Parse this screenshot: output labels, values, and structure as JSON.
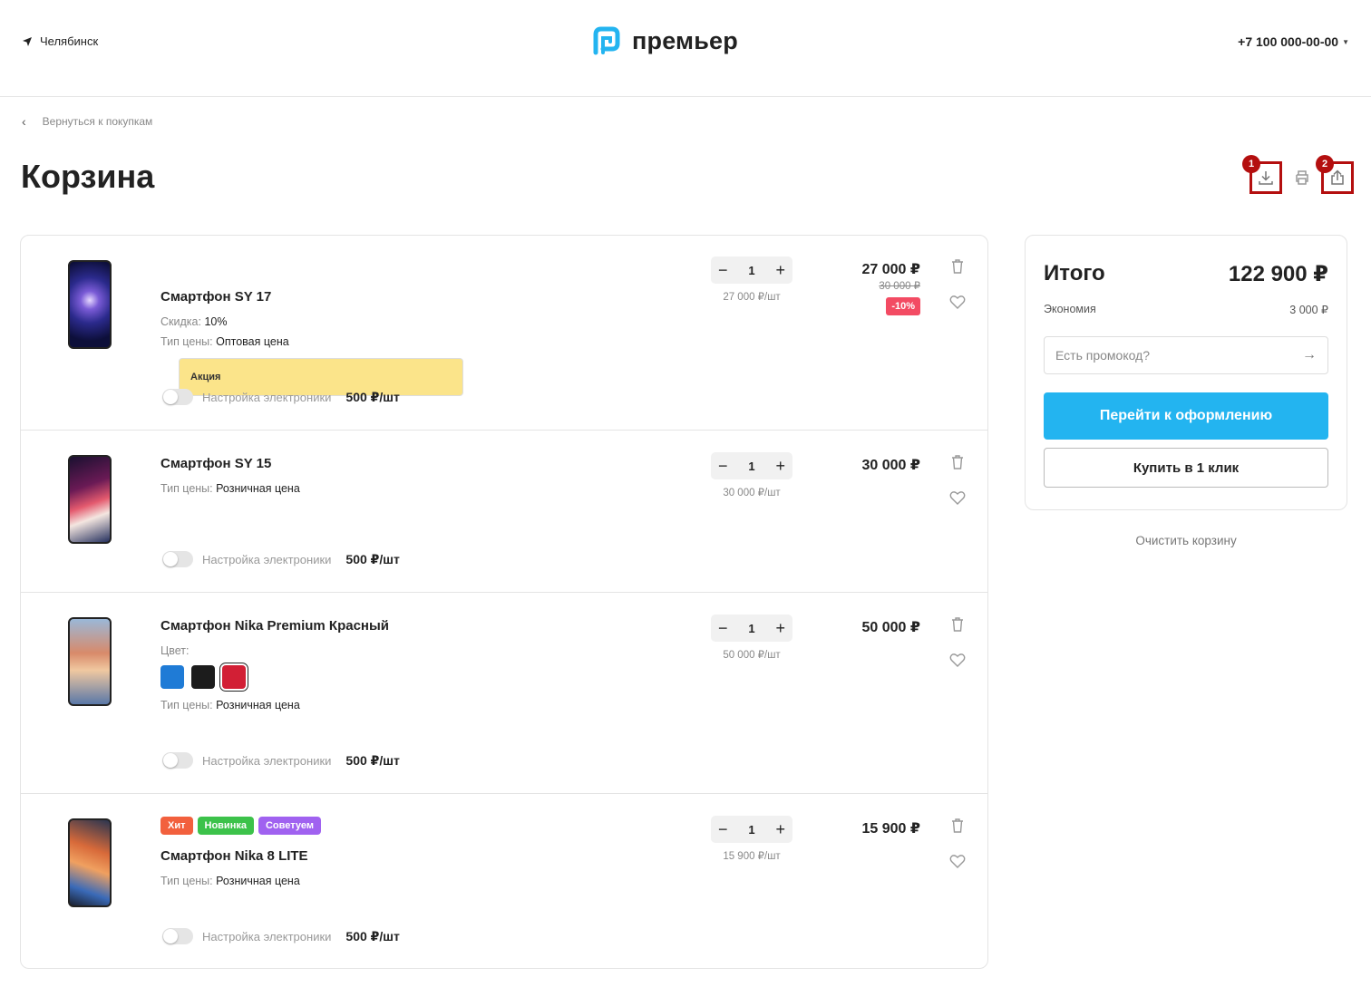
{
  "header": {
    "city": "Челябинск",
    "logo_text": "премьер",
    "phone": "+7 100 000-00-00",
    "brand_color": "#23b4f0"
  },
  "back_link": "Вернуться к покупкам",
  "page_title": "Корзина",
  "toolbar": {
    "markers": [
      "1",
      "2"
    ],
    "icons": [
      "download-icon",
      "print-icon",
      "share-icon"
    ]
  },
  "items": [
    {
      "badges": [
        "Акция"
      ],
      "name": "Смартфон SY 17",
      "props": [
        {
          "label": "Скидка:",
          "value": "10%"
        },
        {
          "label": "Тип цены:",
          "value": "Оптовая цена"
        }
      ],
      "service_label": "Настройка электроники",
      "service_price": "500 ₽/шт",
      "qty": "1",
      "unit_price": "27 000 ₽/шт",
      "total": "27 000 ₽",
      "old_price": "30 000 ₽",
      "discount": "-10%"
    },
    {
      "badges": [],
      "name": "Смартфон SY 15",
      "props": [
        {
          "label": "Тип цены:",
          "value": "Розничная цена"
        }
      ],
      "service_label": "Настройка электроники",
      "service_price": "500 ₽/шт",
      "qty": "1",
      "unit_price": "30 000 ₽/шт",
      "total": "30 000 ₽"
    },
    {
      "badges": [],
      "name": "Смартфон Nika Premium Красный",
      "color_label": "Цвет:",
      "colors": [
        "#1f7bd6",
        "#1c1c1c",
        "#d21f35"
      ],
      "selected_color": 2,
      "props": [
        {
          "label": "Тип цены:",
          "value": "Розничная цена"
        }
      ],
      "service_label": "Настройка электроники",
      "service_price": "500 ₽/шт",
      "qty": "1",
      "unit_price": "50 000 ₽/шт",
      "total": "50 000 ₽"
    },
    {
      "badges": [
        "Хит",
        "Новинка",
        "Советуем"
      ],
      "name": "Смартфон Nika 8 LITE",
      "props": [
        {
          "label": "Тип цены:",
          "value": "Розничная цена"
        }
      ],
      "service_label": "Настройка электроники",
      "service_price": "500 ₽/шт",
      "qty": "1",
      "unit_price": "15 900 ₽/шт",
      "total": "15 900 ₽"
    }
  ],
  "summary": {
    "title": "Итого",
    "total": "122 900 ₽",
    "savings_label": "Экономия",
    "savings_value": "3 000 ₽",
    "promo_placeholder": "Есть промокод?",
    "checkout_label": "Перейти к оформлению",
    "one_click_label": "Купить в 1 клик"
  },
  "clear_cart": "Очистить корзину"
}
